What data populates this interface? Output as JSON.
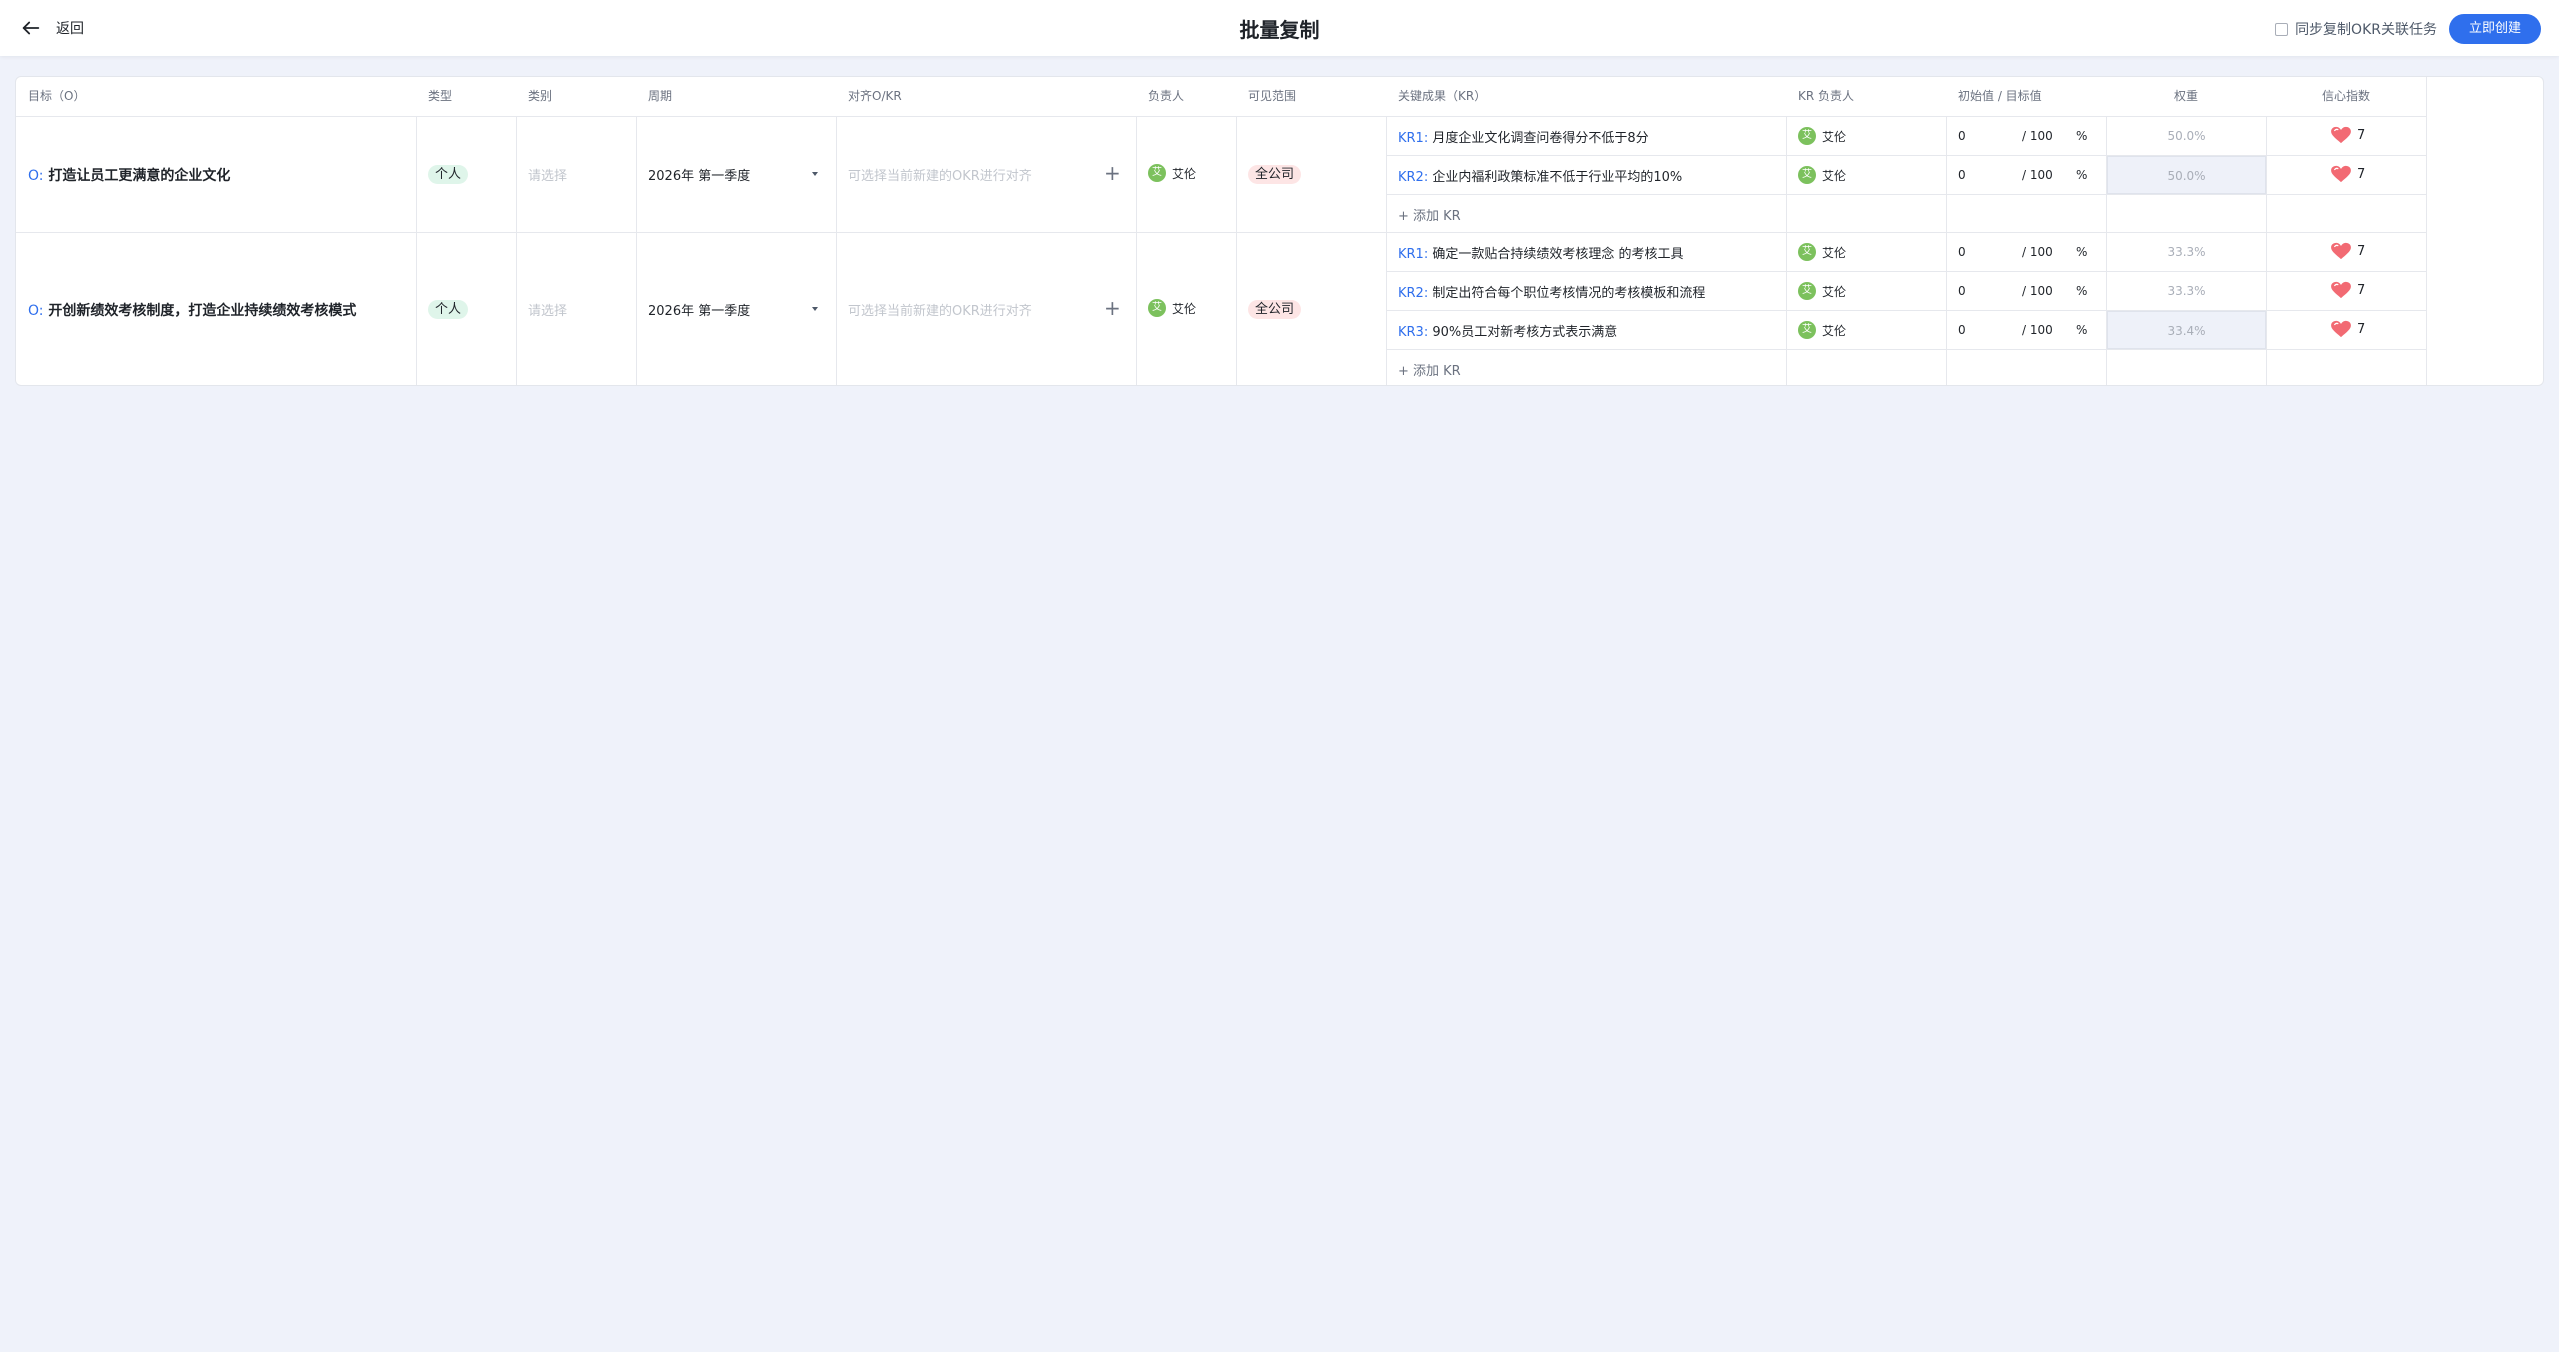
{
  "header": {
    "back_label": "返回",
    "title": "批量复制",
    "sync_label": "同步复制OKR关联任务",
    "create_label": "立即创建"
  },
  "columns": {
    "objective": "目标（O）",
    "type": "类型",
    "category": "类别",
    "period": "周期",
    "align": "对齐O/KR",
    "owner": "负责人",
    "visibility": "可见范围",
    "kr": "关键成果（KR）",
    "kr_owner": "KR 负责人",
    "values": "初始值 / 目标值",
    "weight": "权重",
    "confidence": "信心指数"
  },
  "objectives": [
    {
      "prefix": "O:",
      "text": "打造让员工更满意的企业文化",
      "type": "个人",
      "category_placeholder": "请选择",
      "period": "2026年 第一季度",
      "align_placeholder": "可选择当前新建的OKR进行对齐",
      "owner": "艾伦",
      "owner_initial": "艾",
      "visibility": "全公司",
      "add_kr": "+ 添加 KR",
      "krs": [
        {
          "prefix": "KR1:",
          "text": "月度企业文化调查问卷得分不低于8分",
          "owner": "艾伦",
          "owner_initial": "艾",
          "start": "0",
          "target": "/ 100",
          "unit": "%",
          "weight": "50.0%",
          "confidence": "7"
        },
        {
          "prefix": "KR2:",
          "text": "企业内福利政策标准不低于行业平均的10%",
          "owner": "艾伦",
          "owner_initial": "艾",
          "start": "0",
          "target": "/ 100",
          "unit": "%",
          "weight": "50.0%",
          "confidence": "7"
        }
      ]
    },
    {
      "prefix": "O:",
      "text": "开创新绩效考核制度，打造企业持续绩效考核模式",
      "type": "个人",
      "category_placeholder": "请选择",
      "period": "2026年 第一季度",
      "align_placeholder": "可选择当前新建的OKR进行对齐",
      "owner": "艾伦",
      "owner_initial": "艾",
      "visibility": "全公司",
      "add_kr": "+ 添加 KR",
      "krs": [
        {
          "prefix": "KR1:",
          "text": "确定一款贴合持续绩效考核理念 的考核工具",
          "owner": "艾伦",
          "owner_initial": "艾",
          "start": "0",
          "target": "/ 100",
          "unit": "%",
          "weight": "33.3%",
          "confidence": "7"
        },
        {
          "prefix": "KR2:",
          "text": "制定出符合每个职位考核情况的考核模板和流程",
          "owner": "艾伦",
          "owner_initial": "艾",
          "start": "0",
          "target": "/ 100",
          "unit": "%",
          "weight": "33.3%",
          "confidence": "7"
        },
        {
          "prefix": "KR3:",
          "text": "90%员工对新考核方式表示满意",
          "owner": "艾伦",
          "owner_initial": "艾",
          "start": "0",
          "target": "/ 100",
          "unit": "%",
          "weight": "33.4%",
          "confidence": "7"
        }
      ]
    }
  ],
  "icons": {
    "back": "arrow-left-icon",
    "confidence": "heart-icon",
    "add": "plus-icon",
    "dropdown": "caret-down-icon"
  },
  "colors": {
    "accent": "#2f6fed",
    "background": "#eff2fa",
    "tag_personal": "#dff5ea",
    "tag_company": "#fde5e5",
    "avatar": "#7cc15d",
    "heart": "#f26a73"
  }
}
